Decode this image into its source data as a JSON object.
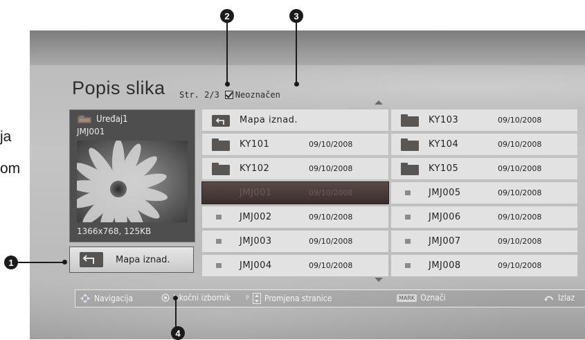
{
  "margin_text": [
    "ja",
    "om"
  ],
  "header": {
    "title": "Popis slika",
    "page": "Str. 2/3",
    "checkbox_label": "Neoznačen"
  },
  "preview": {
    "device": "Uređaj1",
    "photo_name": "JMJ001",
    "photo_info": "1366x768, 125KB",
    "up_folder_label": "Mapa iznad."
  },
  "grid": {
    "left": [
      {
        "type": "folder-up",
        "name": "Mapa iznad.",
        "date": ""
      },
      {
        "type": "folder",
        "name": "KY101",
        "date": "09/10/2008"
      },
      {
        "type": "folder",
        "name": "KY102",
        "date": "09/10/2008"
      },
      {
        "type": "photo",
        "name": "JMJ001",
        "date": "09/10/2008",
        "selected": true
      },
      {
        "type": "photo",
        "name": "JMJ002",
        "date": "09/10/2008"
      },
      {
        "type": "photo",
        "name": "JMJ003",
        "date": "09/10/2008"
      },
      {
        "type": "photo",
        "name": "JMJ004",
        "date": "09/10/2008"
      }
    ],
    "right": [
      {
        "type": "folder",
        "name": "KY103",
        "date": "09/10/2008"
      },
      {
        "type": "folder",
        "name": "KY104",
        "date": "09/10/2008"
      },
      {
        "type": "folder",
        "name": "KY105",
        "date": "09/10/2008"
      },
      {
        "type": "photo",
        "name": "JMJ005",
        "date": "09/10/2008"
      },
      {
        "type": "photo",
        "name": "JMJ006",
        "date": "09/10/2008"
      },
      {
        "type": "photo",
        "name": "JMJ007",
        "date": "09/10/2008"
      },
      {
        "type": "photo",
        "name": "JMJ008",
        "date": "09/10/2008"
      }
    ]
  },
  "bottom_bar": {
    "navigation": "Navigacija",
    "popup_menu": "Iskočni izbornik",
    "page_change_key": "P",
    "page_change": "Promjena stranice",
    "mark_key": "MARK",
    "mark": "Označi",
    "exit": "Izlaz"
  },
  "callouts": [
    "1",
    "2",
    "3",
    "4"
  ],
  "icons": {
    "device": "usb-device-icon",
    "navigation": "navigation-arrows-icon",
    "popup_menu": "ok-button-icon",
    "page_change": "page-up-down-icon",
    "exit": "return-icon"
  }
}
